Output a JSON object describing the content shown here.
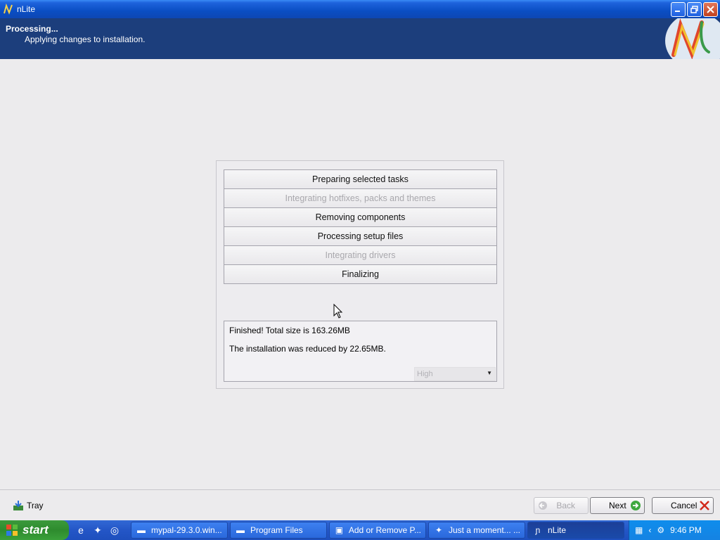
{
  "window": {
    "title": "nLite"
  },
  "header": {
    "title": "Processing...",
    "subtitle": "Applying changes to installation."
  },
  "tasks": [
    {
      "label": "Preparing selected tasks",
      "enabled": true
    },
    {
      "label": "Integrating hotfixes, packs and themes",
      "enabled": false
    },
    {
      "label": "Removing components",
      "enabled": true
    },
    {
      "label": "Processing setup files",
      "enabled": true
    },
    {
      "label": "Integrating drivers",
      "enabled": false
    },
    {
      "label": "Finalizing",
      "enabled": true
    }
  ],
  "result": {
    "line1": "Finished! Total size is 163.26MB",
    "line2": "The installation was reduced by 22.65MB.",
    "priority_select": "High"
  },
  "footer": {
    "tray_label": "Tray",
    "back_label": "Back",
    "next_label": "Next",
    "cancel_label": "Cancel"
  },
  "taskbar": {
    "start_label": "start",
    "items": [
      {
        "label": "mypal-29.3.0.win...",
        "icon": "folder-icon"
      },
      {
        "label": "Program Files",
        "icon": "folder-icon"
      },
      {
        "label": "Add or Remove P...",
        "icon": "control-panel-icon"
      },
      {
        "label": "Just a moment... ...",
        "icon": "browser-icon"
      },
      {
        "label": "nLite",
        "icon": "nlite-icon"
      }
    ],
    "clock": "9:46 PM"
  },
  "colors": {
    "header_bg": "#1c3e7c",
    "titlebar": "#0a4ec4",
    "taskbar": "#2456c7",
    "start_green": "#2e8b2e"
  }
}
